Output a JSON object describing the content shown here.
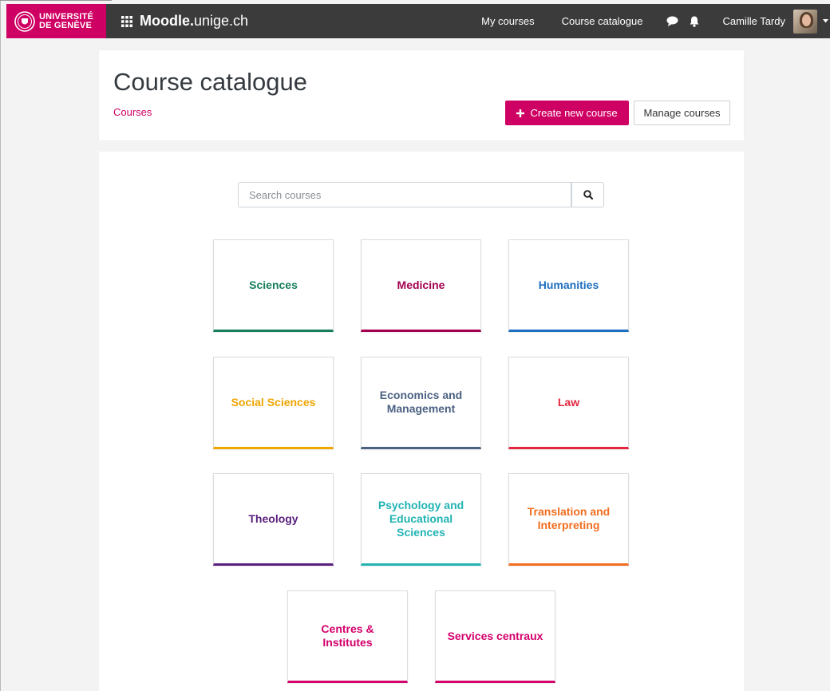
{
  "navbar": {
    "university_line1": "UNIVERSITÉ",
    "university_line2": "DE GENÈVE",
    "site_name_bold": "Moodle.",
    "site_name_rest": "unige.ch",
    "links": [
      "My courses",
      "Course catalogue"
    ],
    "user_name": "Camille Tardy",
    "icons": [
      "apps-grid-icon",
      "chat-bubble-icon",
      "bell-icon",
      "caret-down-icon"
    ]
  },
  "header": {
    "title": "Course catalogue",
    "breadcrumb": "Courses",
    "create_button": "Create new course",
    "manage_button": "Manage courses"
  },
  "search": {
    "placeholder": "Search courses"
  },
  "categories": [
    {
      "name": "Sciences",
      "color": "#167e5c"
    },
    {
      "name": "Medicine",
      "color": "#a3004f"
    },
    {
      "name": "Humanities",
      "color": "#1d6fc0"
    },
    {
      "name": "Social Sciences",
      "color": "#f0a500"
    },
    {
      "name": "Economics and Management",
      "color": "#4b6283"
    },
    {
      "name": "Law",
      "color": "#e3273f"
    },
    {
      "name": "Theology",
      "color": "#5a1f7d"
    },
    {
      "name": "Psychology and Educational Sciences",
      "color": "#23b3b3"
    },
    {
      "name": "Translation and Interpreting",
      "color": "#f26d1f"
    },
    {
      "name": "Centres & Institutes",
      "color": "#d4006b"
    },
    {
      "name": "Services centraux",
      "color": "#d4006b"
    }
  ],
  "colors": {
    "brand": "#cf0063",
    "navbar": "#3b3b3b"
  }
}
